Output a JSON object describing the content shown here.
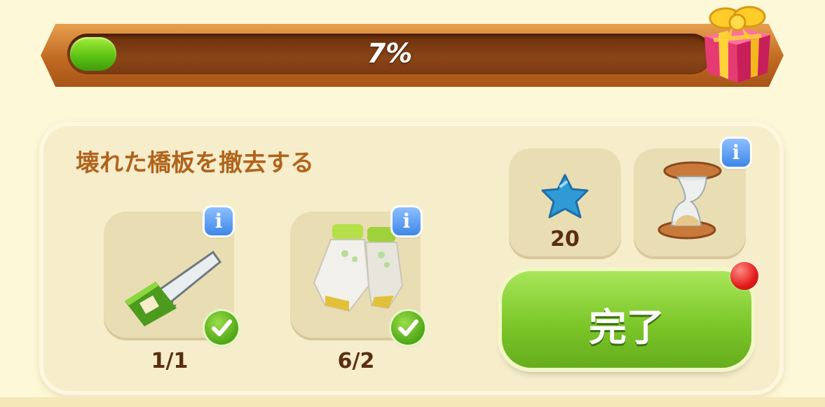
{
  "progress": {
    "label": "7%",
    "value": 0.07
  },
  "gift": {
    "icon": "gift-box-icon"
  },
  "task": {
    "title": "壊れた橋板を撤去する",
    "requirements": [
      {
        "icon": "saw-icon",
        "count": "1/1",
        "completed": true
      },
      {
        "icon": "gloves-icon",
        "count": "6/2",
        "completed": true
      }
    ]
  },
  "cost": {
    "icon": "blue-star-icon",
    "amount": "20"
  },
  "timer": {
    "icon": "hourglass-icon"
  },
  "complete_button": {
    "label": "完了",
    "has_notification": true
  },
  "colors": {
    "accent_green": "#7cc72a",
    "bar_brown": "#c06a22",
    "title_brown": "#b0641c",
    "info_blue": "#3f86e8"
  }
}
